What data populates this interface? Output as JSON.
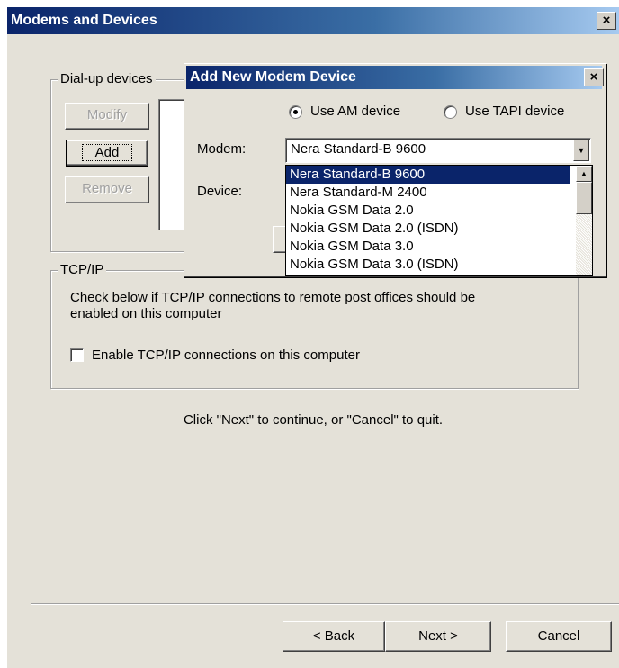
{
  "window": {
    "title": "Modems and Devices",
    "close_glyph": "×"
  },
  "dialup": {
    "legend": "Dial-up devices",
    "modify_label": "Modify",
    "add_label": "Add",
    "remove_label": "Remove"
  },
  "tcpip": {
    "legend": "TCP/IP",
    "description": "Check below if TCP/IP connections to remote post offices should be enabled on this computer",
    "checkbox_label": "Enable TCP/IP connections on this computer",
    "checked": false
  },
  "instruction": "Click \"Next\" to continue, or \"Cancel\" to quit.",
  "nav": {
    "back_label": "< Back",
    "next_label": "Next >",
    "cancel_label": "Cancel"
  },
  "add_modem_dialog": {
    "title": "Add New Modem Device",
    "radio_am_label": "Use AM device",
    "radio_tapi_label": "Use TAPI device",
    "selected_radio": "Use AM device",
    "modem_label": "Modem:",
    "device_label": "Device:",
    "modem_value": "Nera Standard-B 9600",
    "options": [
      "Nera Standard-B 9600",
      "Nera Standard-M 2400",
      "Nokia GSM Data 2.0",
      "Nokia GSM Data 2.0 (ISDN)",
      "Nokia GSM Data 3.0",
      "Nokia GSM Data 3.0 (ISDN)"
    ],
    "selected_option_index": 0
  }
}
